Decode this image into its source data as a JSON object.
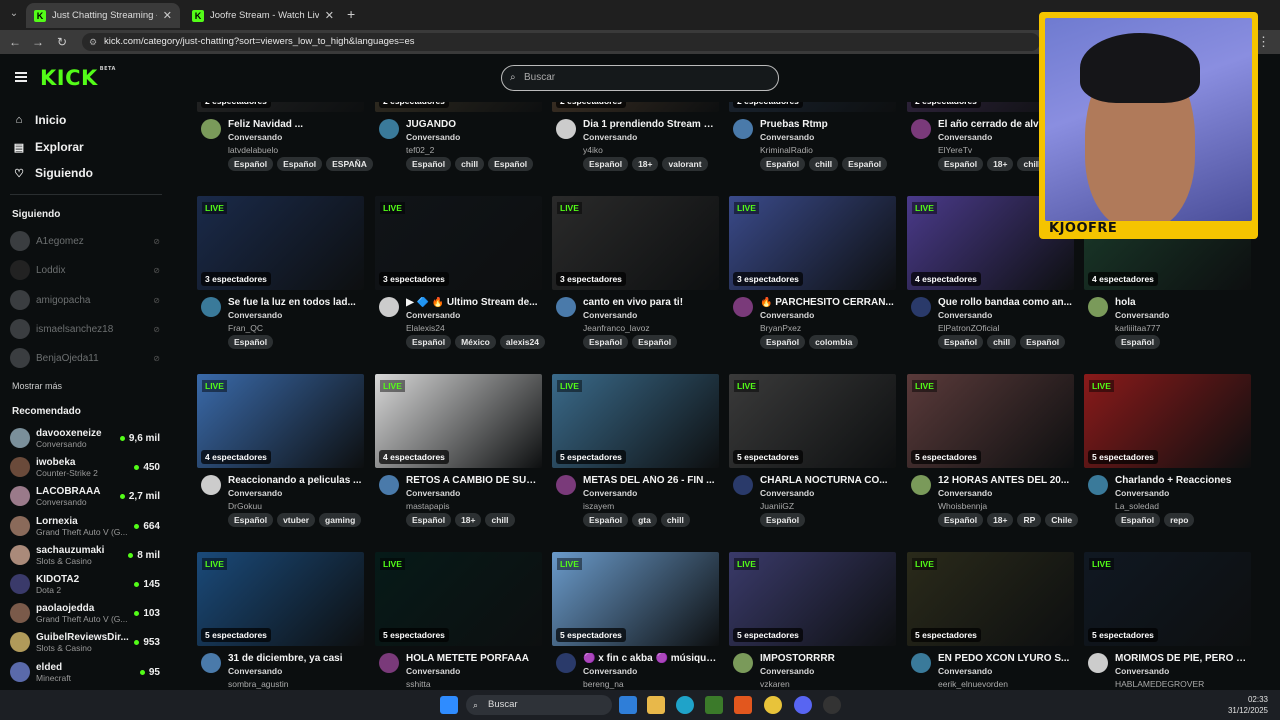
{
  "browser": {
    "tabs": [
      {
        "title": "Just Chatting Streaming - Live S",
        "active": true
      },
      {
        "title": "Joofre Stream - Watch Live on K",
        "active": false
      }
    ],
    "url": "kick.com/category/just-chatting?sort=viewers_low_to_high&languages=es"
  },
  "header": {
    "logo": "KICK",
    "beta": "BETA",
    "search_placeholder": "Buscar"
  },
  "sidebar": {
    "nav": [
      {
        "label": "Inicio",
        "icon": "home-icon"
      },
      {
        "label": "Explorar",
        "icon": "browse-icon"
      },
      {
        "label": "Siguiendo",
        "icon": "heart-icon"
      }
    ],
    "following_title": "Siguiendo",
    "following": [
      "A1egomez",
      "Loddix",
      "amigopacha",
      "ismaelsanchez18",
      "BenjaOjeda11"
    ],
    "show_more": "Mostrar más",
    "recommended_title": "Recomendado",
    "recommended": [
      {
        "name": "davooxeneize",
        "category": "Conversando",
        "viewers": "9,6 mil"
      },
      {
        "name": "iwobeka",
        "category": "Counter-Strike 2",
        "viewers": "450"
      },
      {
        "name": "LACOBRAAA",
        "category": "Conversando",
        "viewers": "2,7 mil"
      },
      {
        "name": "Lornexia",
        "category": "Grand Theft Auto V (G...",
        "viewers": "664"
      },
      {
        "name": "sachauzumaki",
        "category": "Slots & Casino",
        "viewers": "8 mil"
      },
      {
        "name": "KIDOTA2",
        "category": "Dota 2",
        "viewers": "145"
      },
      {
        "name": "paolaojedda",
        "category": "Grand Theft Auto V (G...",
        "viewers": "103"
      },
      {
        "name": "GuibelReviewsDir...",
        "category": "Slots & Casino",
        "viewers": "953"
      },
      {
        "name": "elded",
        "category": "Minecraft",
        "viewers": "95"
      }
    ]
  },
  "grid": {
    "live_label": "LIVE",
    "rows": [
      [
        {
          "viewers": "2 espectadores",
          "title": "Feliz Navidad ...",
          "category": "Conversando",
          "user": "latvdelabuelo",
          "tags": [
            "Español",
            "Español",
            "ESPAÑA"
          ]
        },
        {
          "viewers": "2 espectadores",
          "title": "JUGANDO",
          "category": "Conversando",
          "user": "tef02_2",
          "tags": [
            "Español",
            "chill",
            "Español"
          ]
        },
        {
          "viewers": "2 espectadores",
          "title": "Dia 1 prendiendo Stream h...",
          "category": "Conversando",
          "user": "y4iko",
          "tags": [
            "Español",
            "18+",
            "valorant"
          ]
        },
        {
          "viewers": "2 espectadores",
          "title": "Pruebas Rtmp",
          "category": "Conversando",
          "user": "KriminalRadio",
          "tags": [
            "Español",
            "chill",
            "Español"
          ]
        },
        {
          "viewers": "2 espectadores",
          "title": "El año cerrado de alv p",
          "category": "Conversando",
          "user": "ElYereTv",
          "tags": [
            "Español",
            "18+",
            "chill"
          ]
        }
      ],
      [
        {
          "viewers": "3 espectadores",
          "title": "Se fue la luz en todos lad...",
          "category": "Conversando",
          "user": "Fran_QC",
          "tags": [
            "Español"
          ]
        },
        {
          "viewers": "3 espectadores",
          "title": "▶ 🔷 🔥 Ultimo Stream de...",
          "category": "Conversando",
          "user": "Elalexis24",
          "tags": [
            "Español",
            "México",
            "alexis24"
          ]
        },
        {
          "viewers": "3 espectadores",
          "title": "canto en vivo para ti!",
          "category": "Conversando",
          "user": "Jeanfranco_lavoz",
          "tags": [
            "Español",
            "Español"
          ]
        },
        {
          "viewers": "3 espectadores",
          "title": "🔥 PARCHESITO CERRAN...",
          "category": "Conversando",
          "user": "BryanPxez",
          "tags": [
            "Español",
            "colombia"
          ]
        },
        {
          "viewers": "4 espectadores",
          "title": "Que rollo bandaa como an...",
          "category": "Conversando",
          "user": "ElPatronZOficial",
          "tags": [
            "Español",
            "chill",
            "Español"
          ]
        },
        {
          "viewers": "4 espectadores",
          "title": "hola",
          "category": "Conversando",
          "user": "karliiitaa777",
          "tags": [
            "Español"
          ]
        }
      ],
      [
        {
          "viewers": "4 espectadores",
          "title": "Reaccionando a peliculas ...",
          "category": "Conversando",
          "user": "DrGokuu",
          "tags": [
            "Español",
            "vtuber",
            "gaming"
          ]
        },
        {
          "viewers": "4 espectadores",
          "title": "RETOS A CAMBIO DE SUB...",
          "category": "Conversando",
          "user": "mastapapis",
          "tags": [
            "Español",
            "18+",
            "chill"
          ]
        },
        {
          "viewers": "5 espectadores",
          "title": "METAS DEL AÑO 26 - FIN ...",
          "category": "Conversando",
          "user": "iszayem",
          "tags": [
            "Español",
            "gta",
            "chill"
          ]
        },
        {
          "viewers": "5 espectadores",
          "title": "CHARLA NOCTURNA CO...",
          "category": "Conversando",
          "user": "JuaniiGZ",
          "tags": [
            "Español"
          ]
        },
        {
          "viewers": "5 espectadores",
          "title": "12 HORAS ANTES DEL 20...",
          "category": "Conversando",
          "user": "Whoisbennja",
          "tags": [
            "Español",
            "18+",
            "RP",
            "Chile"
          ]
        },
        {
          "viewers": "5 espectadores",
          "title": "Charlando + Reacciones",
          "category": "Conversando",
          "user": "La_soledad",
          "tags": [
            "Español",
            "repo"
          ]
        }
      ],
      [
        {
          "viewers": "5 espectadores",
          "title": "31 de diciembre, ya casi",
          "category": "Conversando",
          "user": "sombra_agustin",
          "tags": []
        },
        {
          "viewers": "5 espectadores",
          "title": "HOLA METETE PORFAAA",
          "category": "Conversando",
          "user": "sshitta",
          "tags": []
        },
        {
          "viewers": "5 espectadores",
          "title": "🟣 x fin c akba 🟣 músiquit...",
          "category": "Conversando",
          "user": "bereng_na",
          "tags": []
        },
        {
          "viewers": "5 espectadores",
          "title": "IMPOSTORRRR",
          "category": "Conversando",
          "user": "vzkaren",
          "tags": []
        },
        {
          "viewers": "5 espectadores",
          "title": "EN PEDO XCON LYURO S...",
          "category": "Conversando",
          "user": "eerik_elnuevorden",
          "tags": []
        },
        {
          "viewers": "5 espectadores",
          "title": "MORIMOS DE PIE, PERO N...",
          "category": "Conversando",
          "user": "HABLAMEDEGROVER",
          "tags": []
        }
      ]
    ]
  },
  "overlay": {
    "webcam_label": "KJOOFRE"
  },
  "taskbar": {
    "search_placeholder": "Buscar",
    "time": "02:33",
    "date": "31/12/2025"
  },
  "colors": {
    "accent": "#53fc18",
    "overlay_frame": "#f5c400"
  }
}
